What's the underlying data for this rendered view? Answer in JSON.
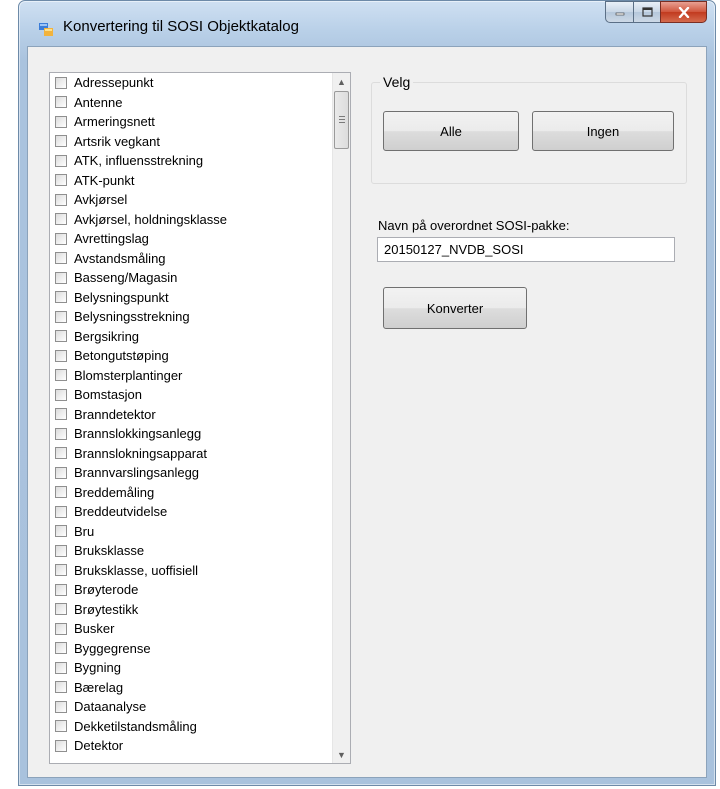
{
  "window": {
    "title": "Konvertering til SOSI Objektkatalog",
    "controls": {
      "minimize": "–",
      "maximize": "☐",
      "close": "✕"
    }
  },
  "object_list": {
    "items": [
      "Adressepunkt",
      "Antenne",
      "Armeringsnett",
      "Artsrik vegkant",
      "ATK, influensstrekning",
      "ATK-punkt",
      "Avkjørsel",
      "Avkjørsel, holdningsklasse",
      "Avrettingslag",
      "Avstandsmåling",
      "Basseng/Magasin",
      "Belysningspunkt",
      "Belysningsstrekning",
      "Bergsikring",
      "Betongutstøping",
      "Blomsterplantinger",
      "Bomstasjon",
      "Branndetektor",
      "Brannslokkingsanlegg",
      "Brannslokningsapparat",
      "Brannvarslingsanlegg",
      "Breddemåling",
      "Breddeutvidelse",
      "Bru",
      "Bruksklasse",
      "Bruksklasse, uoffisiell",
      "Brøyterode",
      "Brøytestikk",
      "Busker",
      "Byggegrense",
      "Bygning",
      "Bærelag",
      "Dataanalyse",
      "Dekketilstandsmåling",
      "Detektor"
    ],
    "checked": [],
    "scroll": {
      "up": "▲",
      "down": "▼"
    }
  },
  "select_group": {
    "label": "Velg",
    "all_label": "Alle",
    "none_label": "Ingen"
  },
  "package": {
    "label": "Navn på overordnet SOSI-pakke:",
    "value": "20150127_NVDB_SOSI"
  },
  "convert_label": "Konverter",
  "colors": {
    "frame": "#a9c2dd",
    "client": "#f0f0f0",
    "close_button": "#c23a1f"
  }
}
